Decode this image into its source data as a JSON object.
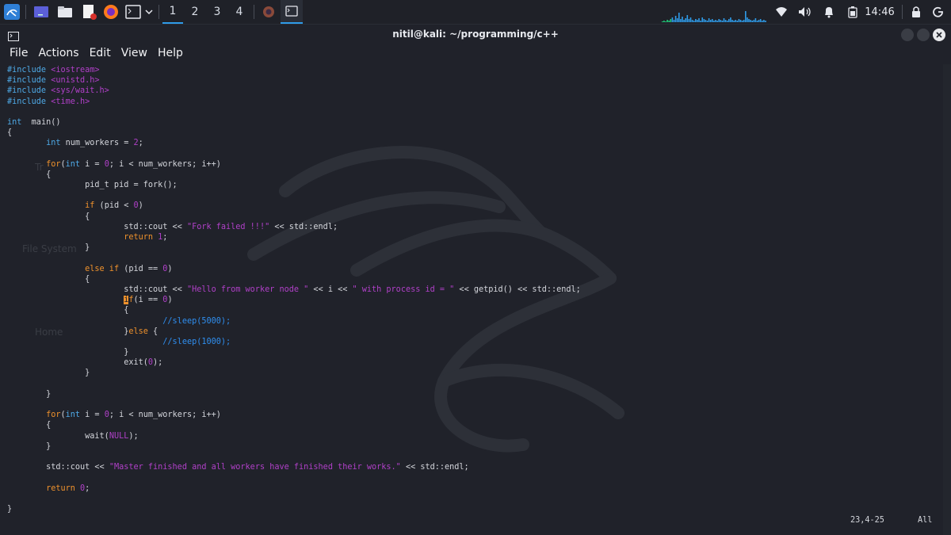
{
  "panel": {
    "workspaces": [
      "1",
      "2",
      "3",
      "4"
    ],
    "active_workspace": "1",
    "clock": "14:46",
    "launchers": [
      "kali-menu-icon",
      "desktop-icon",
      "file-manager-icon",
      "text-editor-icon",
      "firefox-icon",
      "terminal-icon"
    ],
    "tray_icons": [
      "wifi-icon",
      "volume-icon",
      "notification-bell-icon",
      "battery-icon",
      "lock-icon",
      "power-icon"
    ]
  },
  "window": {
    "title": "nitil@kali: ~/programming/c++",
    "menu": [
      "File",
      "Actions",
      "Edit",
      "View",
      "Help"
    ],
    "buttons": [
      "minimize-button",
      "maximize-button",
      "close-button"
    ],
    "accent": "#2f9be8"
  },
  "desktop_ghost": {
    "filesystem_label": "File System",
    "home_label": "Home",
    "trash_label": "Tr"
  },
  "editor": {
    "lines": [
      [
        [
          "pp",
          "#include "
        ],
        [
          "st",
          "<iostream>"
        ]
      ],
      [
        [
          "pp",
          "#include "
        ],
        [
          "st",
          "<unistd.h>"
        ]
      ],
      [
        [
          "pp",
          "#include "
        ],
        [
          "st",
          "<sys/wait.h>"
        ]
      ],
      [
        [
          "pp",
          "#include "
        ],
        [
          "st",
          "<time.h>"
        ]
      ],
      [],
      [
        [
          "ty",
          "int"
        ],
        [
          "",
          "  main()"
        ]
      ],
      [
        [
          "",
          "{"
        ]
      ],
      [
        [
          "",
          "        "
        ],
        [
          "ty",
          "int"
        ],
        [
          "",
          " num_workers = "
        ],
        [
          "nu",
          "2"
        ],
        [
          "",
          ";"
        ]
      ],
      [],
      [
        [
          "",
          "        "
        ],
        [
          "kw",
          "for"
        ],
        [
          "",
          "("
        ],
        [
          "ty",
          "int"
        ],
        [
          "",
          " i = "
        ],
        [
          "nu",
          "0"
        ],
        [
          "",
          "; i < num_workers; i++)"
        ]
      ],
      [
        [
          "",
          "        {"
        ]
      ],
      [
        [
          "",
          "                pid_t pid = fork();"
        ]
      ],
      [],
      [
        [
          "",
          "                "
        ],
        [
          "kw",
          "if"
        ],
        [
          "",
          " (pid < "
        ],
        [
          "nu",
          "0"
        ],
        [
          "",
          ")"
        ]
      ],
      [
        [
          "",
          "                {"
        ]
      ],
      [
        [
          "",
          "                        std::cout << "
        ],
        [
          "st",
          "\"Fork failed !!!\""
        ],
        [
          "",
          " << std::endl;"
        ]
      ],
      [
        [
          "",
          "                        "
        ],
        [
          "kw",
          "return"
        ],
        [
          "",
          " "
        ],
        [
          "nu",
          "1"
        ],
        [
          "",
          ";"
        ]
      ],
      [
        [
          "",
          "                }"
        ]
      ],
      [],
      [
        [
          "",
          "                "
        ],
        [
          "kw",
          "else if"
        ],
        [
          "",
          " (pid == "
        ],
        [
          "nu",
          "0"
        ],
        [
          "",
          ")"
        ]
      ],
      [
        [
          "",
          "                {"
        ]
      ],
      [
        [
          "",
          "                        std::cout << "
        ],
        [
          "st",
          "\"Hello from worker node \""
        ],
        [
          "",
          " << i << "
        ],
        [
          "st",
          "\" with process id = \""
        ],
        [
          "",
          " << getpid() << std::endl;"
        ]
      ],
      [
        [
          "",
          "                        "
        ],
        [
          "cur",
          "i"
        ],
        [
          "kw",
          "f"
        ],
        [
          "",
          "(i == "
        ],
        [
          "nu",
          "0"
        ],
        [
          "",
          ")"
        ]
      ],
      [
        [
          "",
          "                        {"
        ]
      ],
      [
        [
          "",
          "                                "
        ],
        [
          "cm",
          "//sleep(5000);"
        ]
      ],
      [
        [
          "",
          "                        }"
        ],
        [
          "kw",
          "else"
        ],
        [
          "",
          " {"
        ]
      ],
      [
        [
          "",
          "                                "
        ],
        [
          "cm",
          "//sleep(1000);"
        ]
      ],
      [
        [
          "",
          "                        }"
        ]
      ],
      [
        [
          "",
          "                        exit("
        ],
        [
          "nu",
          "0"
        ],
        [
          "",
          ");"
        ]
      ],
      [
        [
          "",
          "                }"
        ]
      ],
      [],
      [
        [
          "",
          "        }"
        ]
      ],
      [],
      [
        [
          "",
          "        "
        ],
        [
          "kw",
          "for"
        ],
        [
          "",
          "("
        ],
        [
          "ty",
          "int"
        ],
        [
          "",
          " i = "
        ],
        [
          "nu",
          "0"
        ],
        [
          "",
          "; i < num_workers; i++)"
        ]
      ],
      [
        [
          "",
          "        {"
        ]
      ],
      [
        [
          "",
          "                wait("
        ],
        [
          "nu",
          "NULL"
        ],
        [
          "",
          ");"
        ]
      ],
      [
        [
          "",
          "        }"
        ]
      ],
      [],
      [
        [
          "",
          "        std::cout << "
        ],
        [
          "st",
          "\"Master finished and all workers have finished their works.\""
        ],
        [
          "",
          " << std::endl;"
        ]
      ],
      [],
      [
        [
          "",
          "        "
        ],
        [
          "kw",
          "return"
        ],
        [
          "",
          " "
        ],
        [
          "nu",
          "0"
        ],
        [
          "",
          ";"
        ]
      ],
      [],
      [
        [
          "",
          "}"
        ]
      ]
    ]
  },
  "status": {
    "position": "23,4-25",
    "scroll": "All"
  }
}
